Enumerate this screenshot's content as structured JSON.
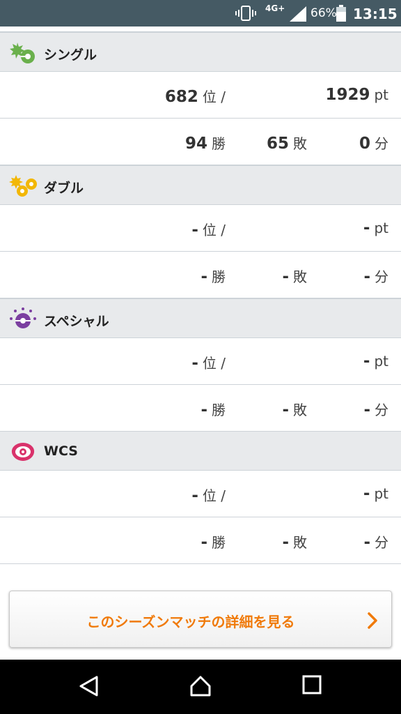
{
  "status_bar": {
    "network": "4G+",
    "battery": "66%",
    "time": "13:15"
  },
  "sections": [
    {
      "title": "シングル",
      "icon": "single-battle-icon",
      "rank": "682",
      "rank_unit": "位 /",
      "points": "1929",
      "points_unit": "pt",
      "wins": "94",
      "wins_unit": "勝",
      "losses": "65",
      "losses_unit": "敗",
      "draws": "0",
      "draws_unit": "分"
    },
    {
      "title": "ダブル",
      "icon": "double-battle-icon",
      "rank": "-",
      "rank_unit": "位 /",
      "points": "-",
      "points_unit": "pt",
      "wins": "-",
      "wins_unit": "勝",
      "losses": "-",
      "losses_unit": "敗",
      "draws": "-",
      "draws_unit": "分"
    },
    {
      "title": "スペシャル",
      "icon": "special-battle-icon",
      "rank": "-",
      "rank_unit": "位 /",
      "points": "-",
      "points_unit": "pt",
      "wins": "-",
      "wins_unit": "勝",
      "losses": "-",
      "losses_unit": "敗",
      "draws": "-",
      "draws_unit": "分"
    },
    {
      "title": "WCS",
      "icon": "wcs-icon",
      "rank": "-",
      "rank_unit": "位 /",
      "points": "-",
      "points_unit": "pt",
      "wins": "-",
      "wins_unit": "勝",
      "losses": "-",
      "losses_unit": "敗",
      "draws": "-",
      "draws_unit": "分"
    }
  ],
  "detail_button": {
    "label": "このシーズンマッチの詳細を見る",
    "icon": "chevron-right-icon"
  },
  "colors": {
    "status_bar": "#455a64",
    "header_bg": "#e8eaec",
    "accent_orange": "#f07a0a",
    "single_green": "#6ab04c",
    "double_yellow": "#f2b705",
    "special_purple": "#7b3fa0",
    "wcs_pink": "#d9326b"
  }
}
